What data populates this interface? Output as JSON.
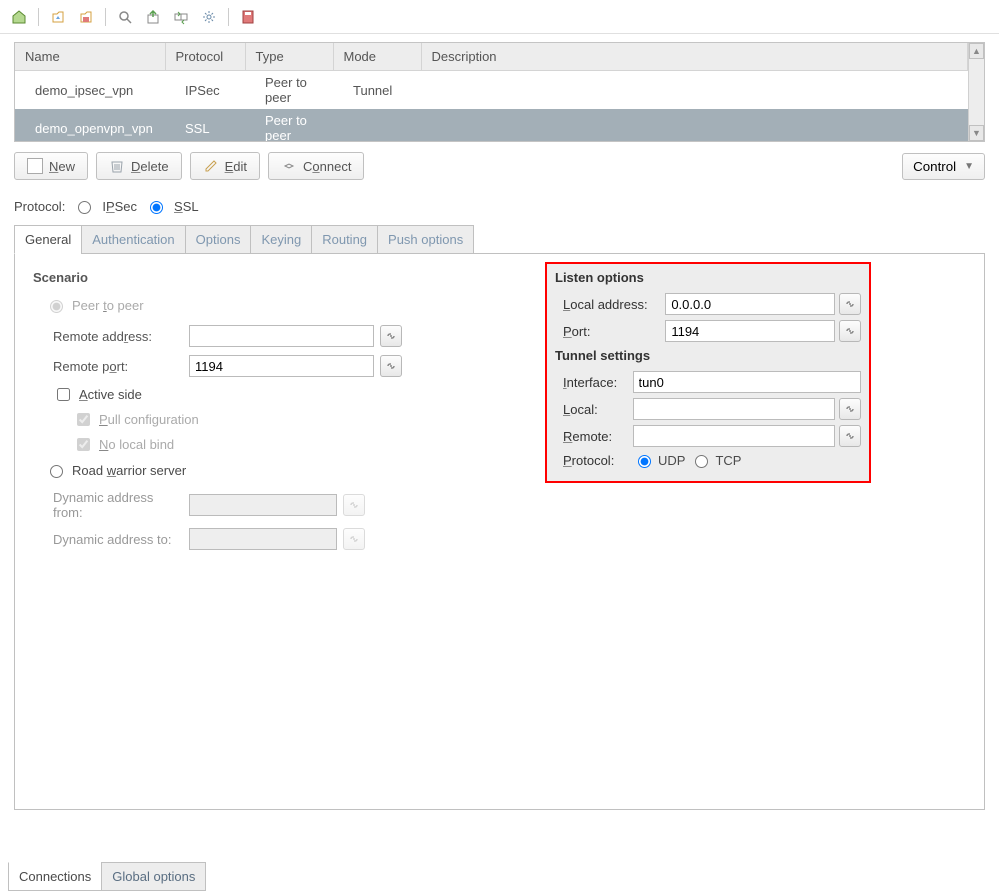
{
  "toolbar": {
    "icons": [
      "home-icon",
      "load-icon",
      "save-icon",
      "search-icon",
      "export-icon",
      "sync-icon",
      "gear-icon",
      "db-save-icon"
    ]
  },
  "table": {
    "headers": {
      "name": "Name",
      "protocol": "Protocol",
      "type": "Type",
      "mode": "Mode",
      "description": "Description"
    },
    "rows": [
      {
        "name": "demo_ipsec_vpn",
        "protocol": "IPSec",
        "type": "Peer to peer",
        "mode": "Tunnel",
        "description": "",
        "selected": false
      },
      {
        "name": "demo_openvpn_vpn",
        "protocol": "SSL",
        "type": "Peer to peer",
        "mode": "",
        "description": "",
        "selected": true
      }
    ]
  },
  "buttons": {
    "new": "New",
    "delete": "Delete",
    "edit": "Edit",
    "connect": "Connect",
    "control": "Control"
  },
  "protocol_line": {
    "label": "Protocol:",
    "ipsec": "IPSec",
    "ssl": "SSL",
    "selected": "ssl"
  },
  "tabs": {
    "general": "General",
    "authentication": "Authentication",
    "options": "Options",
    "keying": "Keying",
    "routing": "Routing",
    "push_options": "Push options"
  },
  "scenario": {
    "title": "Scenario",
    "peer_to_peer": "Peer to peer",
    "remote_address_label": "Remote address:",
    "remote_address_value": "",
    "remote_port_label": "Remote port:",
    "remote_port_value": "1194",
    "active_side": "Active side",
    "pull_config": "Pull configuration",
    "no_local_bind": "No local bind",
    "road_warrior": "Road warrior server",
    "dyn_from_label": "Dynamic address from:",
    "dyn_from_value": "",
    "dyn_to_label": "Dynamic address to:",
    "dyn_to_value": ""
  },
  "listen": {
    "title": "Listen options",
    "local_address_label": "Local address:",
    "local_address_value": "0.0.0.0",
    "port_label": "Port:",
    "port_value": "1194",
    "tunnel_title": "Tunnel settings",
    "interface_label": "Interface:",
    "interface_value": "tun0",
    "local_label": "Local:",
    "local_value": "",
    "remote_label": "Remote:",
    "remote_value": "",
    "protocol_label": "Protocol:",
    "udp": "UDP",
    "tcp": "TCP"
  },
  "bottom_tabs": {
    "connections": "Connections",
    "global_options": "Global options"
  }
}
